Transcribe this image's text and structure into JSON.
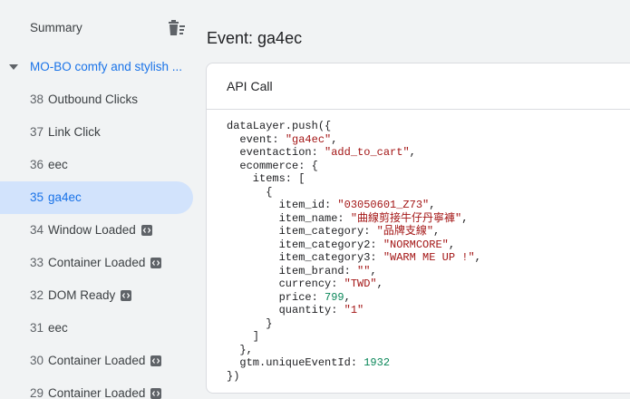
{
  "sidebar": {
    "summary_label": "Summary",
    "container_label": "MO-BO comfy and stylish ...",
    "events": [
      {
        "num": "38",
        "name": "Outbound Clicks",
        "code_icon": false,
        "selected": false
      },
      {
        "num": "37",
        "name": "Link Click",
        "code_icon": false,
        "selected": false
      },
      {
        "num": "36",
        "name": "eec",
        "code_icon": false,
        "selected": false
      },
      {
        "num": "35",
        "name": "ga4ec",
        "code_icon": false,
        "selected": true
      },
      {
        "num": "34",
        "name": "Window Loaded",
        "code_icon": true,
        "selected": false
      },
      {
        "num": "33",
        "name": "Container Loaded",
        "code_icon": true,
        "selected": false
      },
      {
        "num": "32",
        "name": "DOM Ready",
        "code_icon": true,
        "selected": false
      },
      {
        "num": "31",
        "name": "eec",
        "code_icon": false,
        "selected": false
      },
      {
        "num": "30",
        "name": "Container Loaded",
        "code_icon": true,
        "selected": false
      },
      {
        "num": "29",
        "name": "Container Loaded",
        "code_icon": true,
        "selected": false
      }
    ]
  },
  "main": {
    "title": "Event: ga4ec",
    "card_title": "API Call",
    "code": {
      "push_open": "dataLayer.push({",
      "event_key": "  event: ",
      "event_val": "\"ga4ec\"",
      "eventaction_key": "  eventaction: ",
      "eventaction_val": "\"add_to_cart\"",
      "ecommerce_open": "  ecommerce: {",
      "items_open": "    items: [",
      "item_open": "      {",
      "item_id_key": "        item_id: ",
      "item_id_val": "\"03050601_Z73\"",
      "item_name_key": "        item_name: ",
      "item_name_val": "\"曲線剪接牛仔丹寧褲\"",
      "item_category_key": "        item_category: ",
      "item_category_val": "\"品牌支線\"",
      "item_category2_key": "        item_category2: ",
      "item_category2_val": "\"NORMCORE\"",
      "item_category3_key": "        item_category3: ",
      "item_category3_val": "\"WARM ME UP !\"",
      "item_brand_key": "        item_brand: ",
      "item_brand_val": "\"\"",
      "currency_key": "        currency: ",
      "currency_val": "\"TWD\"",
      "price_key": "        price: ",
      "price_val": "799",
      "quantity_key": "        quantity: ",
      "quantity_val": "\"1\"",
      "item_close": "      }",
      "items_close": "    ]",
      "ecommerce_close": "  },",
      "event_id_key": "  gtm.uniqueEventId: ",
      "event_id_val": "1932",
      "push_close": "})"
    }
  },
  "colors": {
    "accent": "#1a73e8",
    "selected_bg": "#d2e3fc",
    "string": "#a31515",
    "number": "#098658"
  },
  "icons": {
    "summary_action": "delete-sweep-icon",
    "container_toggle": "caret-down-icon",
    "event_type": "code-icon"
  }
}
